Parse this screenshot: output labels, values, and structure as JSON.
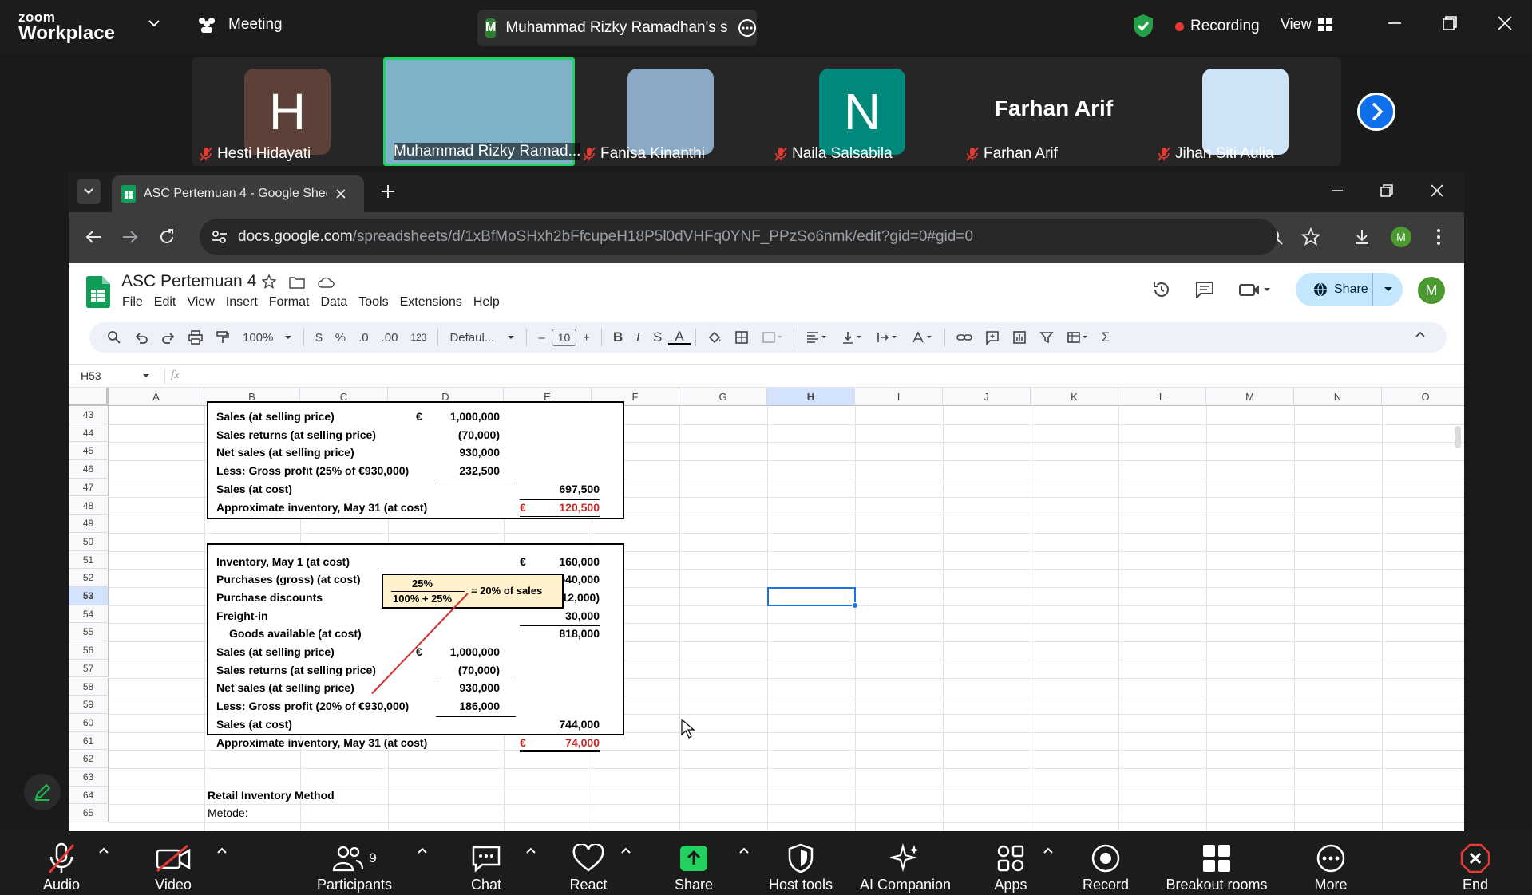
{
  "zoom": {
    "logo_top": "zoom",
    "logo_bottom": "Workplace",
    "meeting_label": "Meeting",
    "speaker_initial": "M",
    "speaker_name": "Muhammad Rizky Ramadhan's s",
    "recording_label": "Recording",
    "view_label": "View",
    "participants": [
      {
        "name": "Hesti Hidayati",
        "initial": "H",
        "color": "#5d4037",
        "muted": true
      },
      {
        "name": "Muhammad Rizky Ramad...",
        "initial": "",
        "color": "#7fb2c9",
        "muted": false,
        "active": true
      },
      {
        "name": "Fanisa Kinanthi",
        "initial": "",
        "color": "#8aa9c4",
        "muted": true
      },
      {
        "name": "Naila Salsabila",
        "initial": "N",
        "color": "#00897b",
        "muted": true
      },
      {
        "name": "Farhan Arif",
        "initial": "",
        "big_name": "Farhan Arif",
        "color": "#262626",
        "muted": true
      },
      {
        "name": "Jihan Siti Aulia",
        "initial": "",
        "color": "#cfe3f7",
        "muted": true
      }
    ],
    "toolbar": [
      {
        "label": "Audio",
        "icon": "mic-muted-icon"
      },
      {
        "label": "Video",
        "icon": "video-off-icon"
      },
      {
        "label": "Participants",
        "icon": "participants-icon",
        "count": "9"
      },
      {
        "label": "Chat",
        "icon": "chat-icon"
      },
      {
        "label": "React",
        "icon": "heart-icon"
      },
      {
        "label": "Share",
        "icon": "share-screen-icon"
      },
      {
        "label": "Host tools",
        "icon": "shield-icon"
      },
      {
        "label": "AI Companion",
        "icon": "sparkle-icon"
      },
      {
        "label": "Apps",
        "icon": "apps-icon"
      },
      {
        "label": "Record",
        "icon": "record-icon"
      },
      {
        "label": "Breakout rooms",
        "icon": "grid-icon"
      },
      {
        "label": "More",
        "icon": "more-icon"
      },
      {
        "label": "End",
        "icon": "end-icon"
      }
    ]
  },
  "browser": {
    "tab_title": "ASC Pertemuan 4 - Google Shee",
    "url_domain": "docs.google.com",
    "url_path": "/spreadsheets/d/1xBfMoSHxh2bFfcupeH18P5l0dVHFq0YNF_PPzSo6nmk/edit?gid=0#gid=0",
    "profile_initial": "M"
  },
  "sheets": {
    "doc_title": "ASC Pertemuan 4",
    "menus": [
      "File",
      "Edit",
      "View",
      "Insert",
      "Format",
      "Data",
      "Tools",
      "Extensions",
      "Help"
    ],
    "share_label": "Share",
    "zoom_level": "100%",
    "font_name": "Defaul...",
    "font_size": "10",
    "number_format": "123",
    "name_box": "H53",
    "fx": "fx",
    "columns": [
      "A",
      "B",
      "C",
      "D",
      "E",
      "F",
      "G",
      "H",
      "I",
      "J",
      "K",
      "L",
      "M",
      "N",
      "O"
    ],
    "rows": [
      "43",
      "44",
      "45",
      "46",
      "47",
      "48",
      "49",
      "50",
      "51",
      "52",
      "53",
      "54",
      "55",
      "56",
      "57",
      "58",
      "59",
      "60",
      "61",
      "62",
      "63",
      "64",
      "65"
    ],
    "box1": [
      {
        "label": "Sales (at selling price)",
        "d_prefix": "€",
        "d": "1,000,000",
        "e": ""
      },
      {
        "label": "Sales returns (at selling price)",
        "d": "(70,000)",
        "e": ""
      },
      {
        "label": "Net sales (at selling price)",
        "d": "930,000",
        "e": ""
      },
      {
        "label": "Less: Gross profit (25% of €930,000)",
        "d": "232,500",
        "e": ""
      },
      {
        "label": "Sales (at cost)",
        "d": "",
        "e": "697,500"
      },
      {
        "label": "Approximate inventory, May 31 (at cost)",
        "d": "",
        "e_prefix": "€",
        "e": "120,500"
      }
    ],
    "box2": [
      {
        "label": "Inventory, May 1 (at cost)",
        "d": "",
        "e_prefix": "€",
        "e": "160,000"
      },
      {
        "label": "Purchases (gross) (at cost)",
        "d": "",
        "e": "640,000"
      },
      {
        "label": "Purchase discounts",
        "d": "",
        "e": "(12,000)"
      },
      {
        "label": "Freight-in",
        "d": "",
        "e": "30,000"
      },
      {
        "label": "Goods available (at cost)",
        "d": "",
        "e": "818,000"
      },
      {
        "label": "Sales (at selling price)",
        "d_prefix": "€",
        "d": "1,000,000",
        "e": ""
      },
      {
        "label": "Sales returns (at selling price)",
        "d": "(70,000)",
        "e": ""
      },
      {
        "label": "Net sales (at selling price)",
        "d": "930,000",
        "e": ""
      },
      {
        "label": "Less: Gross profit (20% of €930,000)",
        "d": "186,000",
        "e": ""
      },
      {
        "label": "Sales (at cost)",
        "d": "",
        "e": "744,000"
      },
      {
        "label": "Approximate inventory, May 31 (at cost)",
        "d": "",
        "e_prefix": "€",
        "e": "74,000"
      }
    ],
    "formula_box": {
      "numerator": "25%",
      "denominator": "100% + 25%",
      "result": "= 20% of sales"
    },
    "b64": "Retail Inventory Method",
    "b65": "Metode:"
  }
}
